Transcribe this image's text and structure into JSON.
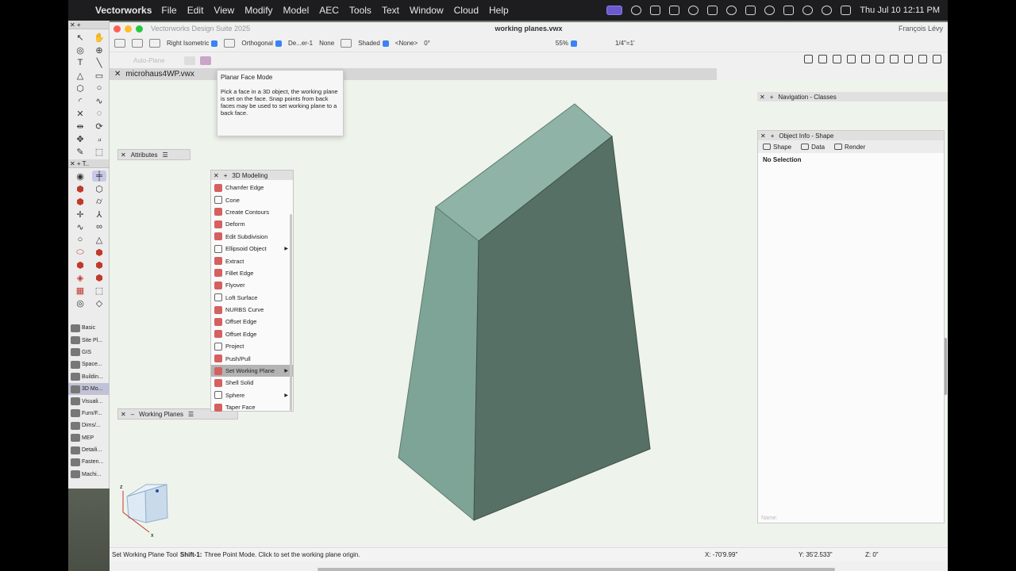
{
  "menubar": {
    "app_name": "Vectorworks",
    "menus": [
      "File",
      "Edit",
      "View",
      "Modify",
      "Model",
      "AEC",
      "Tools",
      "Text",
      "Window",
      "Cloud",
      "Help"
    ],
    "clock": "Thu Jul 10  12:11 PM"
  },
  "window": {
    "suite_title": "Vectorworks Design Suite 2025",
    "doc_title": "working planes.vwx",
    "user": "François Lévy"
  },
  "viewbar": {
    "view": "Right Isometric",
    "projection": "Orthogonal",
    "layer_plane": "De...er-1",
    "none_label": "None",
    "render": "Shaded",
    "class_label": "<None>",
    "rotation": "0°",
    "zoom": "55%",
    "scale": "1/4\"=1'"
  },
  "modebar": {
    "auto_plane": "Auto-Plane"
  },
  "tab": {
    "file_name": "microhaus4WP.vwx"
  },
  "tooltip": {
    "title": "Planar Face Mode",
    "body": "Pick a face in a 3D object, the working plane is set on the face. Snap points from back faces may be used to set working plane to a back face."
  },
  "palettes": {
    "attributes": "Attributes",
    "working_planes": "Working Planes",
    "modeling_title": "3D Modeling",
    "navigation": "Navigation - Classes",
    "object_info": "Object Info - Shape"
  },
  "modeling_tools": [
    {
      "label": "Chamfer Edge",
      "icon": "chamfer-edge-icon",
      "arrow": false
    },
    {
      "label": "Cone",
      "icon": "cone-icon",
      "arrow": false
    },
    {
      "label": "Create Contours",
      "icon": "contours-icon",
      "arrow": false
    },
    {
      "label": "Deform",
      "icon": "deform-icon",
      "arrow": false
    },
    {
      "label": "Edit Subdivision",
      "icon": "subdivision-icon",
      "arrow": false
    },
    {
      "label": "Ellipsoid Object",
      "icon": "ellipsoid-icon",
      "arrow": true
    },
    {
      "label": "Extract",
      "icon": "extract-icon",
      "arrow": false
    },
    {
      "label": "Fillet Edge",
      "icon": "fillet-edge-icon",
      "arrow": false
    },
    {
      "label": "Flyover",
      "icon": "flyover-icon",
      "arrow": false
    },
    {
      "label": "Loft Surface",
      "icon": "loft-surface-icon",
      "arrow": false
    },
    {
      "label": "NURBS Curve",
      "icon": "nurbs-curve-icon",
      "arrow": false
    },
    {
      "label": "Offset Edge",
      "icon": "offset-edge-icon",
      "arrow": false
    },
    {
      "label": "Offset Edge",
      "icon": "offset-edge-icon",
      "arrow": false
    },
    {
      "label": "Project",
      "icon": "project-icon",
      "arrow": false
    },
    {
      "label": "Push/Pull",
      "icon": "push-pull-icon",
      "arrow": false
    },
    {
      "label": "Set Working Plane",
      "icon": "set-working-plane-icon",
      "arrow": true
    },
    {
      "label": "Shell Solid",
      "icon": "shell-solid-icon",
      "arrow": false
    },
    {
      "label": "Sphere",
      "icon": "sphere-icon",
      "arrow": true
    },
    {
      "label": "Taper Face",
      "icon": "taper-face-icon",
      "arrow": false
    }
  ],
  "tool_sets": [
    "Basic",
    "Site Pl...",
    "GIS",
    "Space...",
    "Buildin...",
    "3D Mo...",
    "Visuali...",
    "Furn/F...",
    "Dims/...",
    "MEP",
    "Detaili...",
    "Fasten...",
    "Machi..."
  ],
  "object_info": {
    "tabs": [
      "Shape",
      "Data",
      "Render"
    ],
    "no_selection": "No Selection",
    "name_placeholder": "Name:"
  },
  "statusbar": {
    "tool": "Set Working Plane Tool",
    "shortcut": "Shift-1:",
    "message": "Three Point Mode. Click to set the working plane origin.",
    "x": "X: -70'9.99\"",
    "y": "Y: 35'2.533\"",
    "z": "Z: 0\""
  },
  "colors": {
    "solid_top": "#8fb3a6",
    "solid_left": "#7ea497",
    "solid_right": "#577066",
    "drawing_bg": "#eef3ec",
    "accent": "#3b82f6"
  }
}
